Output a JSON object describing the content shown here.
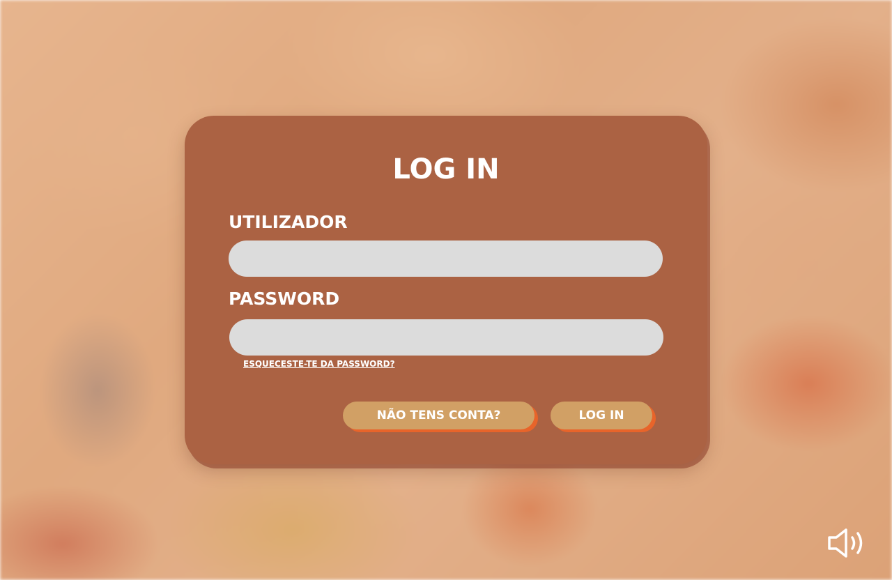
{
  "login_card": {
    "title": "LOG IN",
    "username_label": "UTILIZADOR",
    "username_value": "",
    "password_label": "PASSWORD",
    "password_value": "",
    "forgot_password_link": "ESQUECESTE-TE DA PASSWORD?",
    "register_button": "NÃO TENS CONTA?",
    "login_button": "LOG IN"
  },
  "controls": {
    "sound_icon": "speaker-volume-icon"
  },
  "colors": {
    "card_background": "#ab6243",
    "input_background": "#dcdcdc",
    "button_background": "#d1a065",
    "button_shadow": "#e8642a",
    "text": "#ffffff"
  }
}
